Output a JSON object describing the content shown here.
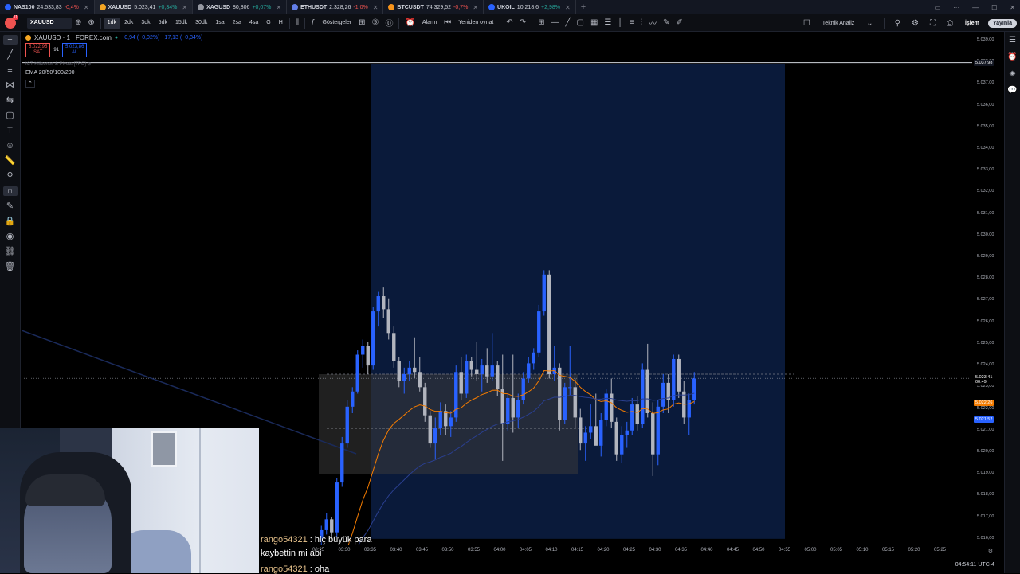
{
  "tabs": [
    {
      "symbol": "NAS100",
      "price": "24.533,83",
      "change": "-0,4%",
      "dir": "down",
      "color": "#2962ff"
    },
    {
      "symbol": "XAUUSD",
      "price": "5.023,41",
      "change": "+0,34%",
      "dir": "up",
      "color": "#f5a623",
      "active": true
    },
    {
      "symbol": "XAGUSD",
      "price": "80,806",
      "change": "+0,07%",
      "dir": "up",
      "color": "#9598a1"
    },
    {
      "symbol": "ETHUSDT",
      "price": "2.328,26",
      "change": "-1,0%",
      "dir": "down",
      "color": "#627eea"
    },
    {
      "symbol": "BTCUSDT",
      "price": "74.329,52",
      "change": "-0,7%",
      "dir": "down",
      "color": "#f7931a"
    },
    {
      "symbol": "UKOIL",
      "price": "10.218,6",
      "change": "+2,98%",
      "dir": "up",
      "color": "#2962ff"
    }
  ],
  "toolbar": {
    "symbol": "XAUUSD",
    "intervals": [
      "1dk",
      "2dk",
      "3dk",
      "5dk",
      "15dk",
      "30dk",
      "1sa",
      "2sa",
      "4sa",
      "G",
      "H"
    ],
    "active_interval": "1dk",
    "indicators_label": "Göstergeler",
    "alarm_label": "Alarm",
    "replay_label": "Yeniden oynat",
    "tech_analysis_label": "Teknik Analiz",
    "trade_label": "İşlem",
    "publish_label": "Yayınla",
    "avatar_badge": "11"
  },
  "legend": {
    "title": "XAUUSD · 1 · FOREX.com",
    "change": "−0,94 (−0,02%) −17,13 (−0,34%)",
    "sell_price": "5.022,95",
    "sell_label": "SAT",
    "spread": "91",
    "buy_price": "5.023,86",
    "buy_label": "AL",
    "indicator1": "ICT Killzones & Pivots [TFO]",
    "indicator2": "EMA 20/50/100/200"
  },
  "price_axis": {
    "labels": [
      "5.039,00",
      "5.038,00",
      "5.037,00",
      "5.036,00",
      "5.035,00",
      "5.034,00",
      "5.033,00",
      "5.032,00",
      "5.031,00",
      "5.030,00",
      "5.029,00",
      "5.028,00",
      "5.027,00",
      "5.026,00",
      "5.025,00",
      "5.024,00",
      "5.023,00",
      "5.022,00",
      "5.021,00",
      "5.020,00",
      "5.019,00",
      "5.018,00",
      "5.017,00",
      "5.016,00"
    ],
    "current_price": "5.023,41",
    "countdown": "00:49",
    "tag_orange": "5.022,26",
    "tag_blue": "5.021,52",
    "top_tag": "5.037,98"
  },
  "time_axis": {
    "labels": [
      "03:25",
      "03:30",
      "03:35",
      "03:40",
      "03:45",
      "03:50",
      "03:55",
      "04:00",
      "04:05",
      "04:10",
      "04:15",
      "04:20",
      "04:25",
      "04:30",
      "04:35",
      "04:40",
      "04:45",
      "04:50",
      "04:55",
      "05:00",
      "05:05",
      "05:10",
      "05:15",
      "05:20",
      "05:25"
    ]
  },
  "status": {
    "clock": "04:54:11 UTC-4"
  },
  "chat": [
    {
      "user": "rango54321",
      "text": " : hiç büyük para"
    },
    {
      "user": "",
      "text": "kaybettin mi abi"
    },
    {
      "user": "rango54321",
      "text": " : oha"
    }
  ],
  "chart_data": {
    "type": "candlestick",
    "x_start": "03:25",
    "x_step_minutes": 1,
    "ohlc": [
      [
        5016.0,
        5016.6,
        5015.6,
        5016.4
      ],
      [
        5016.4,
        5017.2,
        5016.2,
        5016.9
      ],
      [
        5016.9,
        5017.0,
        5016.0,
        5016.3
      ],
      [
        5016.3,
        5018.8,
        5016.1,
        5018.6
      ],
      [
        5018.6,
        5020.7,
        5018.4,
        5020.4
      ],
      [
        5020.4,
        5022.4,
        5020.2,
        5022.1
      ],
      [
        5022.1,
        5023.0,
        5021.8,
        5022.8
      ],
      [
        5022.8,
        5024.7,
        5022.7,
        5024.5
      ],
      [
        5024.5,
        5025.2,
        5023.9,
        5024.9
      ],
      [
        5024.9,
        5025.1,
        5023.6,
        5024.0
      ],
      [
        5024.0,
        5026.7,
        5023.8,
        5026.5
      ],
      [
        5026.5,
        5027.4,
        5025.8,
        5027.2
      ],
      [
        5027.2,
        5027.6,
        5026.2,
        5026.6
      ],
      [
        5026.6,
        5027.1,
        5025.2,
        5025.5
      ],
      [
        5025.5,
        5025.8,
        5023.9,
        5024.2
      ],
      [
        5024.2,
        5024.4,
        5023.0,
        5023.3
      ],
      [
        5023.3,
        5023.9,
        5022.7,
        5023.6
      ],
      [
        5023.6,
        5024.2,
        5023.3,
        5023.9
      ],
      [
        5023.9,
        5025.3,
        5023.4,
        5023.7
      ],
      [
        5023.7,
        5024.4,
        5022.8,
        5023.0
      ],
      [
        5023.0,
        5023.2,
        5021.4,
        5021.7
      ],
      [
        5021.7,
        5021.9,
        5020.2,
        5020.4
      ],
      [
        5020.4,
        5021.6,
        5019.7,
        5021.1
      ],
      [
        5021.1,
        5022.3,
        5020.8,
        5021.9
      ],
      [
        5021.9,
        5022.2,
        5020.8,
        5021.2
      ],
      [
        5021.2,
        5021.9,
        5020.7,
        5021.6
      ],
      [
        5021.6,
        5024.0,
        5021.4,
        5023.7
      ],
      [
        5023.7,
        5024.4,
        5022.4,
        5022.7
      ],
      [
        5022.7,
        5024.5,
        5022.5,
        5024.2
      ],
      [
        5024.2,
        5024.4,
        5023.5,
        5023.8
      ],
      [
        5023.8,
        5025.1,
        5023.3,
        5023.6
      ],
      [
        5023.6,
        5024.3,
        5022.8,
        5024.0
      ],
      [
        5024.0,
        5024.8,
        5023.2,
        5023.5
      ],
      [
        5023.5,
        5025.5,
        5023.3,
        5024.0
      ],
      [
        5024.0,
        5024.2,
        5022.6,
        5022.9
      ],
      [
        5022.9,
        5024.5,
        5019.6,
        5021.3
      ],
      [
        5021.3,
        5022.7,
        5021.0,
        5022.5
      ],
      [
        5022.5,
        5024.5,
        5020.9,
        5021.6
      ],
      [
        5021.6,
        5022.7,
        5021.1,
        5022.4
      ],
      [
        5022.4,
        5023.7,
        5022.2,
        5023.4
      ],
      [
        5023.4,
        5024.4,
        5023.2,
        5024.1
      ],
      [
        5024.1,
        5024.8,
        5023.8,
        5024.6
      ],
      [
        5024.6,
        5026.8,
        5024.4,
        5026.5
      ],
      [
        5026.5,
        5028.4,
        5026.3,
        5028.2
      ],
      [
        5028.2,
        5028.4,
        5023.4,
        5023.6
      ],
      [
        5023.6,
        5024.9,
        5023.3,
        5023.9
      ],
      [
        5023.9,
        5024.1,
        5021.0,
        5021.5
      ],
      [
        5021.5,
        5023.2,
        5021.3,
        5023.0
      ],
      [
        5023.0,
        5024.9,
        5022.6,
        5023.0
      ],
      [
        5023.0,
        5023.4,
        5021.1,
        5021.6
      ],
      [
        5021.6,
        5022.0,
        5020.1,
        5020.4
      ],
      [
        5020.4,
        5021.2,
        5019.6,
        5020.9
      ],
      [
        5020.9,
        5022.2,
        5020.6,
        5021.2
      ],
      [
        5021.2,
        5022.7,
        5020.7,
        5020.3
      ],
      [
        5020.3,
        5021.8,
        5019.8,
        5021.5
      ],
      [
        5021.5,
        5022.9,
        5021.2,
        5022.7
      ],
      [
        5022.7,
        5023.4,
        5021.1,
        5021.4
      ],
      [
        5021.4,
        5021.6,
        5019.6,
        5019.9
      ],
      [
        5019.9,
        5021.2,
        5019.5,
        5020.8
      ],
      [
        5020.8,
        5021.4,
        5020.2,
        5021.0
      ],
      [
        5021.0,
        5022.5,
        5020.8,
        5022.2
      ],
      [
        5022.2,
        5022.6,
        5021.0,
        5021.3
      ],
      [
        5021.3,
        5024.1,
        5021.1,
        5023.8
      ],
      [
        5023.8,
        5025.0,
        5021.6,
        5021.8
      ],
      [
        5021.8,
        5022.3,
        5018.9,
        5019.9
      ],
      [
        5019.9,
        5022.4,
        5019.4,
        5022.1
      ],
      [
        5022.1,
        5023.6,
        5021.8,
        5023.2
      ],
      [
        5023.2,
        5023.6,
        5021.8,
        5022.4
      ],
      [
        5022.4,
        5024.5,
        5022.1,
        5024.3
      ],
      [
        5024.3,
        5024.5,
        5022.5,
        5022.8
      ],
      [
        5022.8,
        5023.3,
        5021.3,
        5021.6
      ],
      [
        5021.6,
        5022.7,
        5020.8,
        5022.4
      ],
      [
        5022.4,
        5023.7,
        5022.2,
        5023.4
      ]
    ],
    "ema_fast": "orange",
    "ema_slow": "blue",
    "ylim": [
      5015.7,
      5039.4
    ],
    "zones": [
      {
        "label": "session box",
        "x_from": "03:35",
        "x_to": "04:55",
        "y_from": 5016.0,
        "y_to": 5037.9,
        "color": "#0a1a3a"
      },
      {
        "label": "range box",
        "x_from": "03:25",
        "x_to": "04:15",
        "y_from": 5019.0,
        "y_to": 5023.6,
        "color": "#3a3a3a"
      }
    ]
  }
}
